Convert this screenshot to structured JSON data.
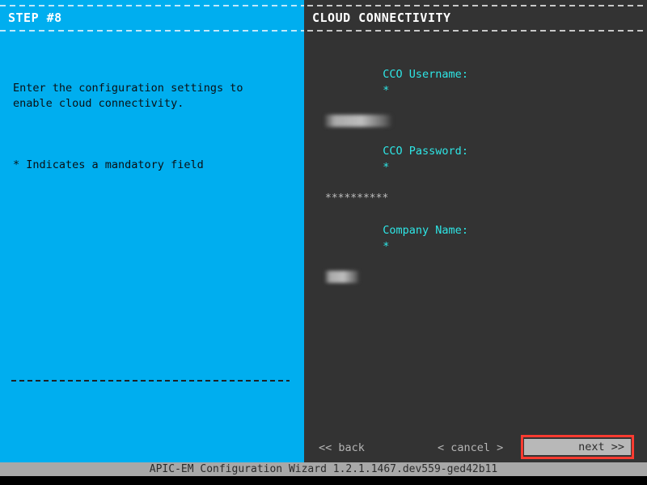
{
  "left_panel": {
    "step_title": "STEP #8",
    "description": "Enter the configuration settings to\nenable cloud connectivity.",
    "mandatory_note": "* Indicates a mandatory field",
    "background_color": "#00AEEF"
  },
  "right_panel": {
    "title": "CLOUD CONNECTIVITY",
    "background_color": "#333333",
    "label_color": "#2ee6e6",
    "fields": [
      {
        "label": "CCO Username:",
        "required_marker": "*",
        "value": "",
        "value_state": "redacted",
        "redaction_width": "wide"
      },
      {
        "label": "CCO Password:",
        "required_marker": "*",
        "value": "**********",
        "value_state": "masked",
        "redaction_width": ""
      },
      {
        "label": "Company Name:",
        "required_marker": "*",
        "value": "",
        "value_state": "redacted",
        "redaction_width": "narrow"
      }
    ]
  },
  "nav": {
    "back_label": "<< back",
    "cancel_label": "< cancel >",
    "next_label": "next >>",
    "next_highlight_color": "#ff3b30",
    "next_selected": true
  },
  "status_bar": {
    "text": "APIC-EM Configuration Wizard 1.2.1.1467.dev559-ged42b11",
    "background_color": "#a8a8a8"
  }
}
